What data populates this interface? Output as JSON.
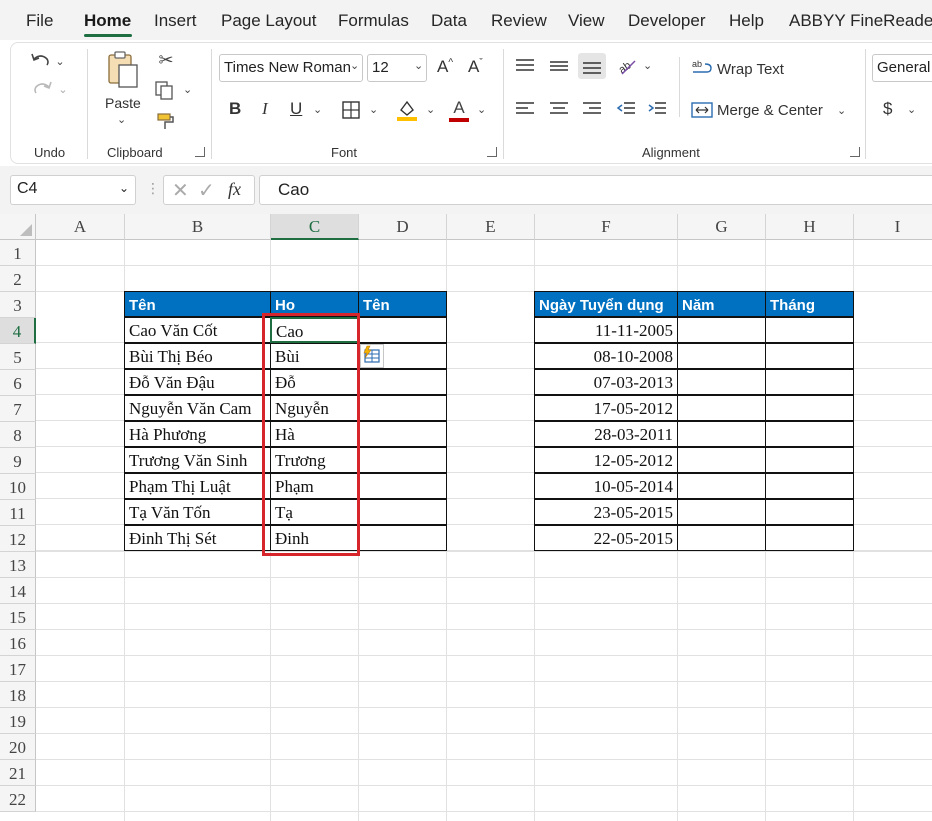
{
  "menu": {
    "tabs": [
      "File",
      "Home",
      "Insert",
      "Page Layout",
      "Formulas",
      "Data",
      "Review",
      "View",
      "Developer",
      "Help",
      "ABBYY FineReader"
    ],
    "active_tab": "Home"
  },
  "ribbon": {
    "undo_group_label": "Undo",
    "clipboard": {
      "paste_label": "Paste",
      "group_label": "Clipboard"
    },
    "font": {
      "family": "Times New Roman",
      "size": "12",
      "group_label": "Font",
      "bold": "B",
      "italic": "I",
      "underline": "U",
      "grow": "A",
      "shrink": "A",
      "font_color_glyph": "A"
    },
    "alignment": {
      "wrap_text": "Wrap Text",
      "merge_center": "Merge & Center",
      "group_label": "Alignment"
    },
    "number": {
      "format": "General",
      "currency": "$"
    },
    "colors": {
      "accent_green": "#1e6e42",
      "fill_yellow": "#ffc000",
      "font_red": "#c00000",
      "font_green": "#107c10"
    }
  },
  "formula_bar": {
    "name_box": "C4",
    "fx": "fx",
    "value": "Cao"
  },
  "grid": {
    "columns": [
      "A",
      "B",
      "C",
      "D",
      "E",
      "F",
      "G",
      "H",
      "I"
    ],
    "selected_column": "C",
    "rows": [
      "1",
      "2",
      "3",
      "4",
      "5",
      "6",
      "7",
      "8",
      "9",
      "10",
      "11",
      "12",
      "13",
      "14",
      "15",
      "16",
      "17",
      "18",
      "19",
      "20",
      "21",
      "22"
    ],
    "selected_row": "4"
  },
  "table1": {
    "headers": [
      "Tên",
      "Ho",
      "Tên"
    ],
    "full_names": [
      "Cao Văn Cốt",
      "Bùi Thị Béo",
      "Đỗ Văn Đậu",
      "Nguyễn Văn Cam",
      "Hà Phương",
      "Trương Văn Sinh",
      "Phạm Thị Luật",
      "Tạ Văn Tốn",
      "Đinh Thị Sét"
    ],
    "last_names": [
      "Cao",
      "Bùi",
      "Đỗ",
      "Nguyễn",
      "Hà",
      "Trương",
      "Phạm",
      "Tạ",
      "Đinh"
    ]
  },
  "table2": {
    "headers": [
      "Ngày Tuyển dụng",
      "Năm",
      "Tháng"
    ],
    "dates": [
      "11-11-2005",
      "08-10-2008",
      "07-03-2013",
      "17-05-2012",
      "28-03-2011",
      "12-05-2012",
      "10-05-2014",
      "23-05-2015",
      "22-05-2015"
    ]
  },
  "highlight_color": "#d6262c",
  "header_fill": "#0070c0"
}
